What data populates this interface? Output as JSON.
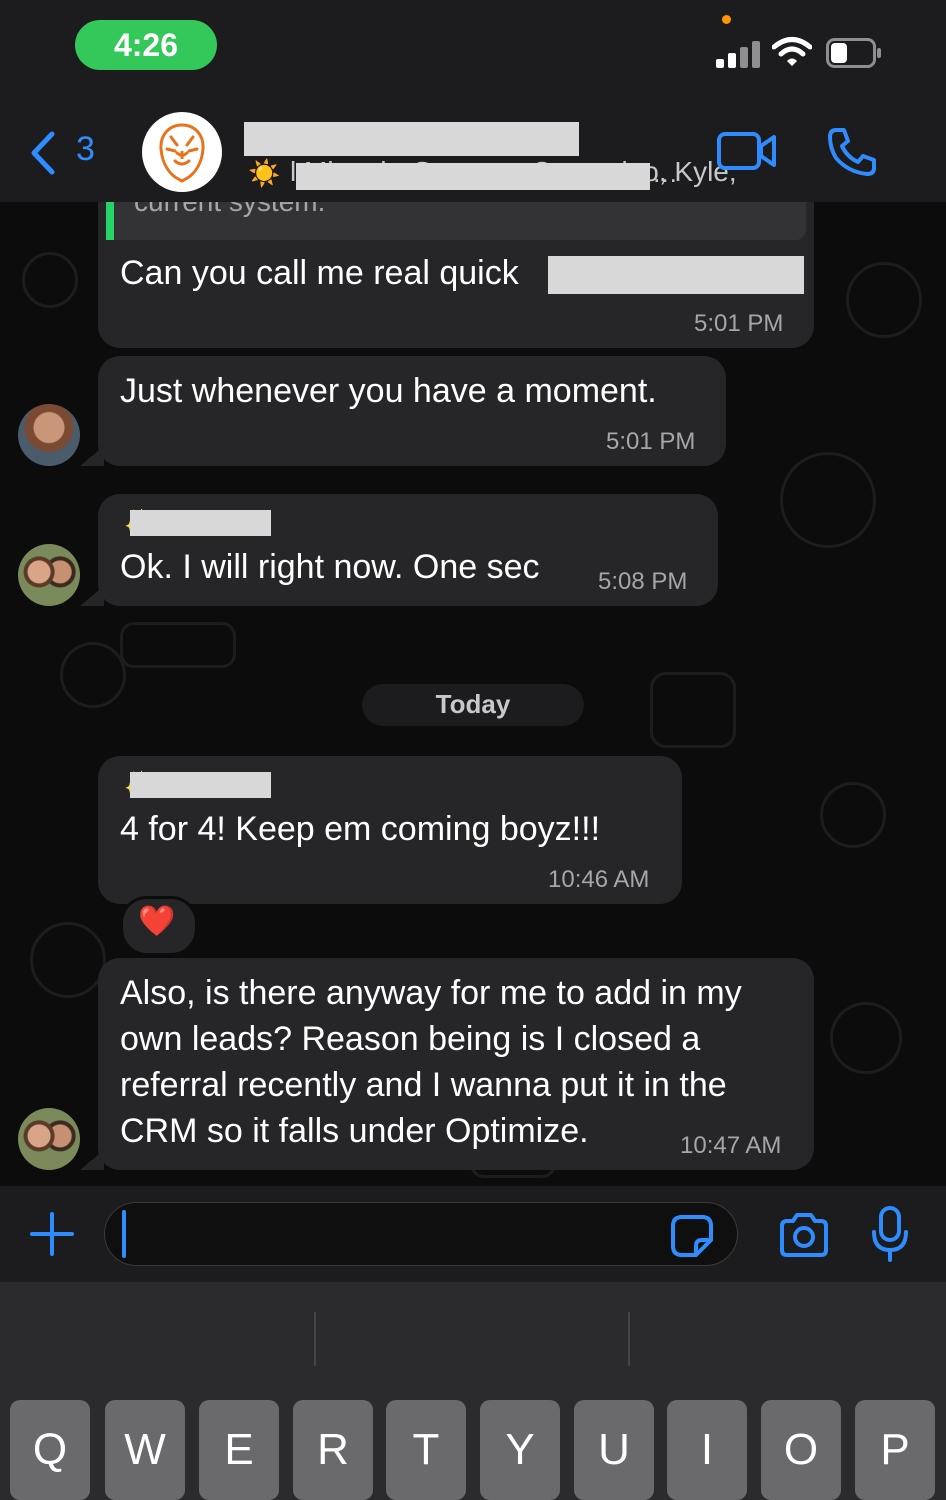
{
  "status_bar": {
    "time": "4:26"
  },
  "header": {
    "back_count": "3",
    "subtitle_prefix": "☀️",
    "subtitle_visible": "l Minnah, Gustavo, Carnavino, Kyle,",
    "subtitle_ellipsis": "…"
  },
  "chat": {
    "quoted_snippet": "current system.",
    "messages": [
      {
        "text": "Can you call me real quick",
        "time": "5:01 PM"
      },
      {
        "text": "Just whenever you have a moment.",
        "time": "5:01 PM"
      },
      {
        "text": "Ok. I will right now. One sec",
        "time": "5:08 PM"
      },
      {
        "text": "4 for 4! Keep em coming boyz!!!",
        "time": "10:46 AM",
        "reaction": "❤️"
      },
      {
        "lines": [
          "Also, is there anyway for me to add in my",
          "own leads? Reason being is I closed a",
          "referral recently and I wanna put it in the",
          "CRM so it falls under Optimize."
        ],
        "time": "10:47 AM"
      }
    ],
    "date_divider": "Today"
  },
  "composer": {
    "placeholder": ""
  },
  "keyboard": {
    "keys": [
      "Q",
      "W",
      "E",
      "R",
      "T",
      "Y",
      "U",
      "I",
      "O",
      "P"
    ]
  },
  "colors": {
    "accent_blue": "#2f8cff",
    "status_green": "#34c759",
    "bubble_bg": "#262628",
    "quote_bar": "#25d366",
    "brand_orange": "#e8731a"
  },
  "icons": [
    "back-chevron-icon",
    "video-call-icon",
    "phone-icon",
    "plus-icon",
    "sticker-icon",
    "camera-icon",
    "microphone-icon",
    "sun-icon",
    "heart-icon",
    "wifi-icon",
    "signal-icon",
    "battery-icon",
    "lion-logo-icon"
  ]
}
